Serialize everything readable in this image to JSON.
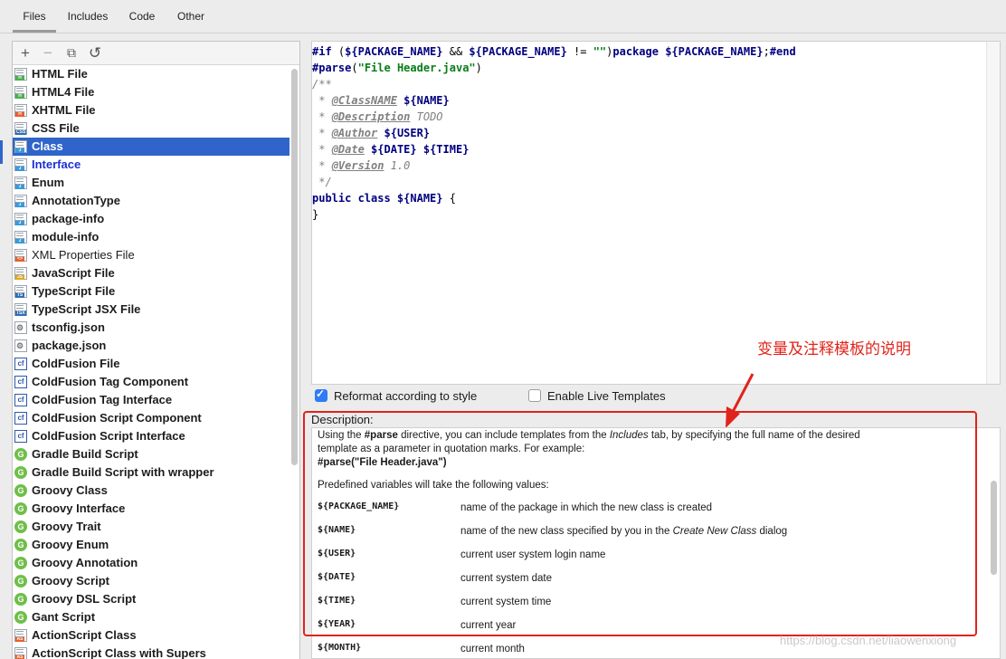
{
  "tabs": [
    {
      "label": "Files",
      "active": true
    },
    {
      "label": "Includes",
      "active": false
    },
    {
      "label": "Code",
      "active": false
    },
    {
      "label": "Other",
      "active": false
    }
  ],
  "toolbar": {
    "add": "+",
    "remove": "−",
    "copy": "⧉",
    "reset": "↺"
  },
  "templates": [
    {
      "label": "HTML File",
      "icon": "html-file-icon",
      "badge": "H",
      "color": "#4caf50",
      "style": "bold"
    },
    {
      "label": "HTML4 File",
      "icon": "html-file-icon",
      "badge": "H",
      "color": "#4caf50",
      "style": "bold"
    },
    {
      "label": "XHTML File",
      "icon": "xhtml-file-icon",
      "badge": "H",
      "color": "#e5622f",
      "style": "bold"
    },
    {
      "label": "CSS File",
      "icon": "css-file-icon",
      "badge": "CSS",
      "color": "#2f6fb5",
      "style": "bold"
    },
    {
      "label": "Class",
      "icon": "java-class-file-icon",
      "badge": "J",
      "color": "#3b9ad9",
      "style": "bold",
      "selected": true
    },
    {
      "label": "Interface",
      "icon": "java-interface-file-icon",
      "badge": "J",
      "color": "#3b9ad9",
      "style": "link"
    },
    {
      "label": "Enum",
      "icon": "java-enum-file-icon",
      "badge": "J",
      "color": "#3b9ad9",
      "style": "bold"
    },
    {
      "label": "AnnotationType",
      "icon": "java-annotation-file-icon",
      "badge": "J",
      "color": "#3b9ad9",
      "style": "bold"
    },
    {
      "label": "package-info",
      "icon": "java-file-icon",
      "badge": "J",
      "color": "#3b9ad9",
      "style": "bold"
    },
    {
      "label": "module-info",
      "icon": "java-file-icon",
      "badge": "J",
      "color": "#3b9ad9",
      "style": "bold"
    },
    {
      "label": "XML Properties File",
      "icon": "xml-file-icon",
      "badge": "<>",
      "color": "#e5622f",
      "style": "normal"
    },
    {
      "label": "JavaScript File",
      "icon": "javascript-file-icon",
      "badge": "JS",
      "color": "#e0a81e",
      "style": "bold"
    },
    {
      "label": "TypeScript File",
      "icon": "typescript-file-icon",
      "badge": "TS",
      "color": "#2f6fb5",
      "style": "bold"
    },
    {
      "label": "TypeScript JSX File",
      "icon": "tsx-file-icon",
      "badge": "TSX",
      "color": "#2f6fb5",
      "style": "bold"
    },
    {
      "label": "tsconfig.json",
      "icon": "json-config-icon",
      "badge": "",
      "color": "#9aa3ad",
      "style": "bold",
      "kind": "gear"
    },
    {
      "label": "package.json",
      "icon": "json-config-icon",
      "badge": "",
      "color": "#9aa3ad",
      "style": "bold",
      "kind": "gear"
    },
    {
      "label": "ColdFusion File",
      "icon": "coldfusion-icon",
      "badge": "",
      "color": "#2f5aa8",
      "style": "bold",
      "kind": "cf"
    },
    {
      "label": "ColdFusion Tag Component",
      "icon": "coldfusion-icon",
      "badge": "",
      "color": "#2f5aa8",
      "style": "bold",
      "kind": "cf"
    },
    {
      "label": "ColdFusion Tag Interface",
      "icon": "coldfusion-icon",
      "badge": "",
      "color": "#2f5aa8",
      "style": "bold",
      "kind": "cf"
    },
    {
      "label": "ColdFusion Script Component",
      "icon": "coldfusion-icon",
      "badge": "",
      "color": "#2f5aa8",
      "style": "bold",
      "kind": "cf"
    },
    {
      "label": "ColdFusion Script Interface",
      "icon": "coldfusion-icon",
      "badge": "",
      "color": "#2f5aa8",
      "style": "bold",
      "kind": "cf"
    },
    {
      "label": "Gradle Build Script",
      "icon": "gradle-icon",
      "badge": "",
      "color": "#6fbf4a",
      "style": "bold",
      "kind": "circle"
    },
    {
      "label": "Gradle Build Script with wrapper",
      "icon": "gradle-icon",
      "badge": "",
      "color": "#6fbf4a",
      "style": "bold",
      "kind": "circle"
    },
    {
      "label": "Groovy Class",
      "icon": "groovy-icon",
      "badge": "",
      "color": "#6fbf4a",
      "style": "bold",
      "kind": "circle"
    },
    {
      "label": "Groovy Interface",
      "icon": "groovy-icon",
      "badge": "",
      "color": "#6fbf4a",
      "style": "bold",
      "kind": "circle"
    },
    {
      "label": "Groovy Trait",
      "icon": "groovy-icon",
      "badge": "",
      "color": "#6fbf4a",
      "style": "bold",
      "kind": "circle"
    },
    {
      "label": "Groovy Enum",
      "icon": "groovy-icon",
      "badge": "",
      "color": "#6fbf4a",
      "style": "bold",
      "kind": "circle"
    },
    {
      "label": "Groovy Annotation",
      "icon": "groovy-icon",
      "badge": "",
      "color": "#6fbf4a",
      "style": "bold",
      "kind": "circle"
    },
    {
      "label": "Groovy Script",
      "icon": "groovy-icon",
      "badge": "",
      "color": "#6fbf4a",
      "style": "bold",
      "kind": "circle"
    },
    {
      "label": "Groovy DSL Script",
      "icon": "groovy-icon",
      "badge": "",
      "color": "#6fbf4a",
      "style": "bold",
      "kind": "circle"
    },
    {
      "label": "Gant Script",
      "icon": "groovy-icon",
      "badge": "",
      "color": "#6fbf4a",
      "style": "bold",
      "kind": "circle"
    },
    {
      "label": "ActionScript Class",
      "icon": "actionscript-icon",
      "badge": "AS",
      "color": "#e5622f",
      "style": "bold"
    },
    {
      "label": "ActionScript Class with Supers",
      "icon": "actionscript-icon",
      "badge": "AS",
      "color": "#e5622f",
      "style": "bold"
    }
  ],
  "editor": {
    "line1": {
      "a": "#if",
      "b": " (",
      "c": "${PACKAGE_NAME}",
      "d": " && ",
      "e": "${PACKAGE_NAME}",
      "f": " != ",
      "g": "\"\"",
      "h": ")",
      "i": "package ",
      "j": "${PACKAGE_NAME}",
      "k": ";",
      "l": "#end"
    },
    "line2": {
      "a": "#parse",
      "b": "(",
      "c": "\"File Header.java\"",
      "d": ")"
    },
    "line3": "/**",
    "line4": {
      "a": " * ",
      "b": "@ClassNAME",
      "c": " ",
      "d": "${NAME}"
    },
    "line5": {
      "a": " * ",
      "b": "@Description",
      "c": " TODO"
    },
    "line6": {
      "a": " * ",
      "b": "@Author",
      "c": " ",
      "d": "${USER}"
    },
    "line7": {
      "a": " * ",
      "b": "@Date",
      "c": " ",
      "d": "${DATE}",
      "e": " ",
      "f": "${TIME}"
    },
    "line8": {
      "a": " * ",
      "b": "@Version",
      "c": " 1.0"
    },
    "line9": " */",
    "line10": {
      "a": "public class ",
      "b": "${NAME}",
      "c": " {"
    },
    "line11": "}"
  },
  "annotation": "变量及注释模板的说明",
  "options": {
    "reformat": {
      "label": "Reformat according to style",
      "checked": true
    },
    "live_templates": {
      "label": "Enable Live Templates",
      "checked": false
    }
  },
  "description": {
    "label": "Description:",
    "intro1": {
      "a": "Using the ",
      "b": "#parse",
      "c": " directive, you can include templates from the ",
      "d": "Includes",
      "e": " tab, by specifying the full name of the desired"
    },
    "intro2": "template as a parameter in quotation marks. For example:",
    "example": "#parse(\"File Header.java\")",
    "predefined": "Predefined variables will take the following values:",
    "variables": [
      {
        "name": "${PACKAGE_NAME}",
        "desc": "name of the package in which the new class is created"
      },
      {
        "name": "${NAME}",
        "desc_a": "name of the new class specified by you in the ",
        "desc_b": "Create New Class",
        "desc_c": " dialog"
      },
      {
        "name": "${USER}",
        "desc": "current user system login name"
      },
      {
        "name": "${DATE}",
        "desc": "current system date"
      },
      {
        "name": "${TIME}",
        "desc": "current system time"
      },
      {
        "name": "${YEAR}",
        "desc": "current year"
      },
      {
        "name": "${MONTH}",
        "desc": "current month"
      }
    ]
  },
  "watermark": "https://blog.csdn.net/liaowenxiong",
  "colors": {
    "selection": "#2f65ca",
    "annotation_red": "#e0241b",
    "checkbox_blue": "#2f7bf5"
  }
}
